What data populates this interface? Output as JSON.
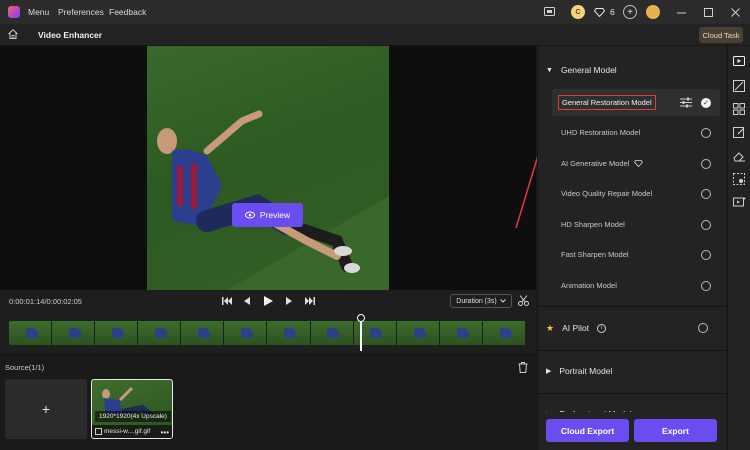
{
  "titlebar": {
    "menu_items": [
      "Menu",
      "Preferences",
      "Feedback"
    ],
    "credits": "6"
  },
  "header": {
    "title": "Video Enhancer",
    "cloud_task": "Cloud Task"
  },
  "preview": {
    "button_label": "Preview"
  },
  "controls": {
    "timecode": "0:00:01:14/0:00:02:05",
    "duration": "Duration (3s)"
  },
  "timeline": {
    "frame_count": 12,
    "playhead_fraction": 0.68
  },
  "source": {
    "title": "Source(1/1)",
    "add_label": "+",
    "thumb": {
      "resolution": "1920*1920(4x Upscale)",
      "filename": "messi-w....gif.gif"
    }
  },
  "panel": {
    "general_model": {
      "title": "General Model",
      "models": [
        {
          "label": "General Restoration Model",
          "selected": true
        },
        {
          "label": "UHD Restoration Model",
          "selected": false
        },
        {
          "label": "AI Generative Model",
          "selected": false
        },
        {
          "label": "Video Quality Repair Model",
          "selected": false
        },
        {
          "label": "HD Sharpen Model",
          "selected": false
        },
        {
          "label": "Fast Sharpen Model",
          "selected": false
        },
        {
          "label": "Animation Model",
          "selected": false
        }
      ]
    },
    "ai_pilot": "AI Pilot",
    "portrait_model": "Portrait Model",
    "professional_model": "Professional Model",
    "cloud_export": "Cloud Export",
    "export": "Export"
  },
  "colors": {
    "accent": "#6a4cf0",
    "highlight_box": "#e23a3a",
    "star": "#f2c14e"
  }
}
